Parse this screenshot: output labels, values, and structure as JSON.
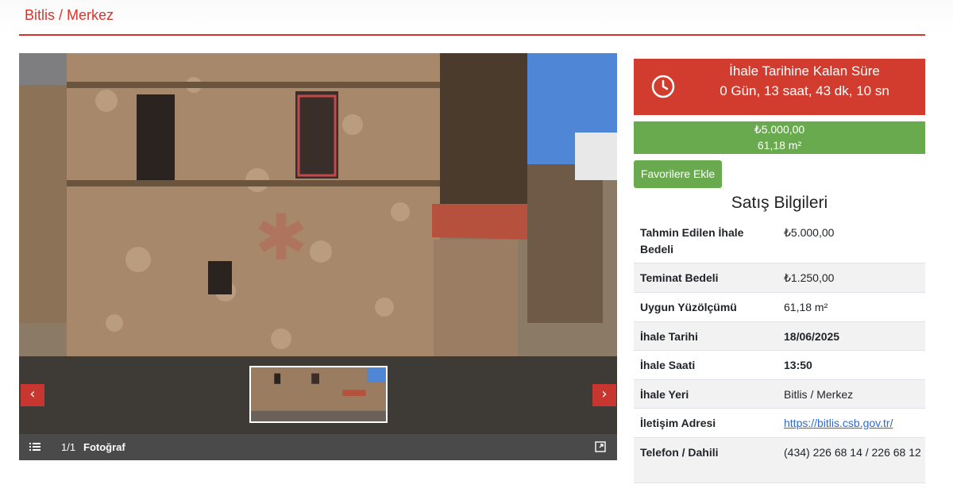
{
  "breadcrumb": "Bitlis / Merkez",
  "gallery": {
    "count": "1/1",
    "caption": "Fotoğraf",
    "prev_icon": "‹",
    "next_icon": "›"
  },
  "countdown": {
    "title": "İhale Tarihine Kalan Süre",
    "remaining": "0 Gün, 13 saat, 43 dk, 10 sn"
  },
  "price_box": {
    "price": "₺5.000,00",
    "area": "61,18 m²"
  },
  "favorite_button": "Favorilere Ekle",
  "section_title": "Satış Bilgileri",
  "details": [
    {
      "label": "Tahmin Edilen İhale Bedeli",
      "value": "₺5.000,00"
    },
    {
      "label": "Teminat Bedeli",
      "value": "₺1.250,00"
    },
    {
      "label": "Uygun Yüzölçümü",
      "value": "61,18 m²"
    },
    {
      "label": "İhale Tarihi",
      "value": "18/06/2025"
    },
    {
      "label": "İhale Saati",
      "value": "13:50"
    },
    {
      "label": "İhale Yeri",
      "value": "Bitlis / Merkez"
    },
    {
      "label": "İletişim Adresi",
      "value": "https://bitlis.csb.gov.tr/"
    },
    {
      "label": "Telefon / Dahili",
      "value": "(434) 226 68 14 / 226 68 12"
    }
  ],
  "colors": {
    "accent_red": "#d23c2f",
    "green": "#6aaa4f",
    "link": "#2a6bd6"
  }
}
